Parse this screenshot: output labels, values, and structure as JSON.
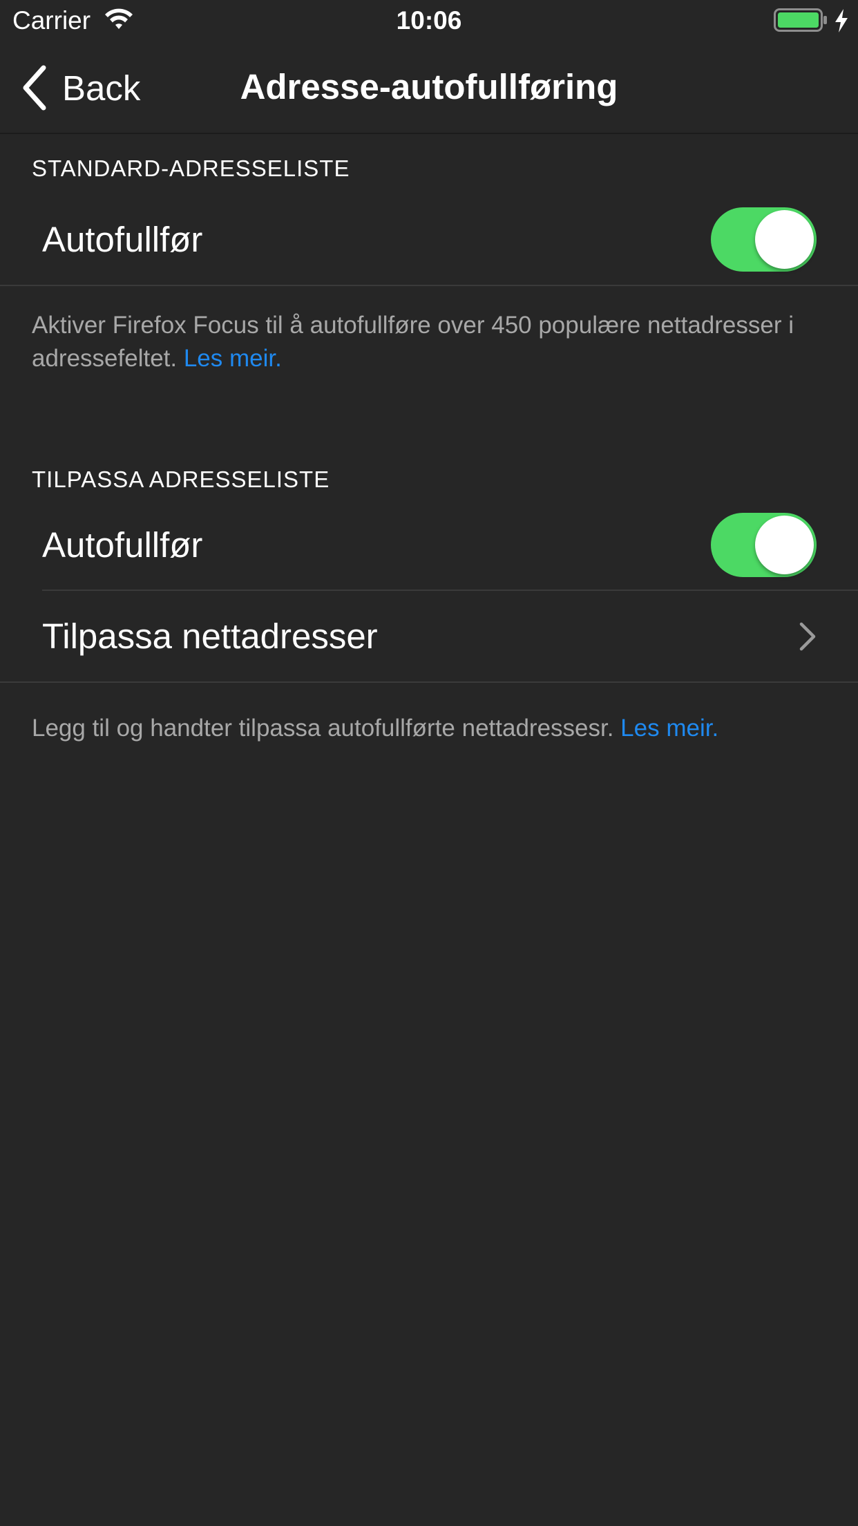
{
  "status_bar": {
    "carrier": "Carrier",
    "time": "10:06",
    "wifi_icon": "wifi-icon",
    "battery_icon": "battery-icon",
    "charging_icon": "charging-bolt-icon",
    "battery_color": "#4cd964"
  },
  "nav": {
    "back_label": "Back",
    "title": "Adresse-autofullføring"
  },
  "default_list": {
    "header": "STANDARD-ADRESSELISTE",
    "autocomplete_label": "Autofullfør",
    "autocomplete_on": true,
    "footer_text": "Aktiver Firefox Focus til å autofullføre over 450 populære nettadresser i adressefeltet. ",
    "footer_link": "Les meir."
  },
  "custom_list": {
    "header": "TILPASSA ADRESSELISTE",
    "autocomplete_label": "Autofullfør",
    "autocomplete_on": true,
    "manage_label": "Tilpassa nettadresser",
    "footer_text": "Legg til og handter tilpassa autofullførte nettadressesr. ",
    "footer_link": "Les meir."
  },
  "colors": {
    "background": "#262626",
    "toggle_on": "#4cd964",
    "link": "#1f89ef",
    "footer_text": "#a8a8a8"
  }
}
